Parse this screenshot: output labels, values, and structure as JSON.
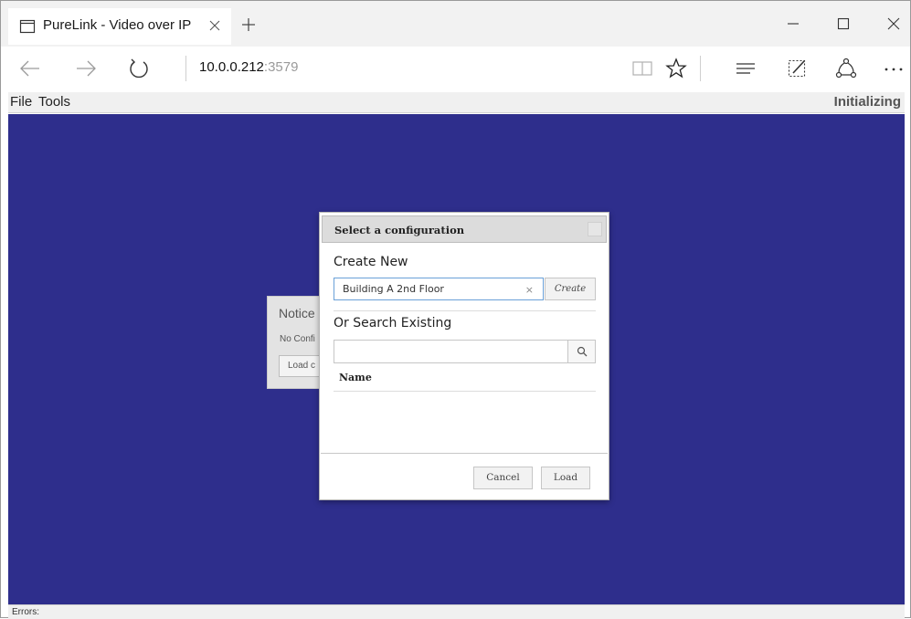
{
  "browser": {
    "tab_title": "PureLink - Video over IP",
    "address_host": "10.0.0.212",
    "address_port": ":3579"
  },
  "menubar": {
    "file_label": "File",
    "tools_label": "Tools",
    "status": "Initializing"
  },
  "notice": {
    "title": "Notice",
    "body": "No Confi",
    "button_label": "Load c"
  },
  "dialog": {
    "title": "Select a configuration",
    "create_new_label": "Create New",
    "name_input_value": "Building A 2nd Floor",
    "clear_symbol": "×",
    "create_button": "Create",
    "search_label": "Or Search Existing",
    "search_value": "",
    "column_name": "Name",
    "rows": [],
    "cancel_button": "Cancel",
    "load_button": "Load"
  },
  "errors_label": "Errors:",
  "colors": {
    "canvas_background": "#2e2e8c",
    "input_focus_border": "#6aa0d8"
  }
}
